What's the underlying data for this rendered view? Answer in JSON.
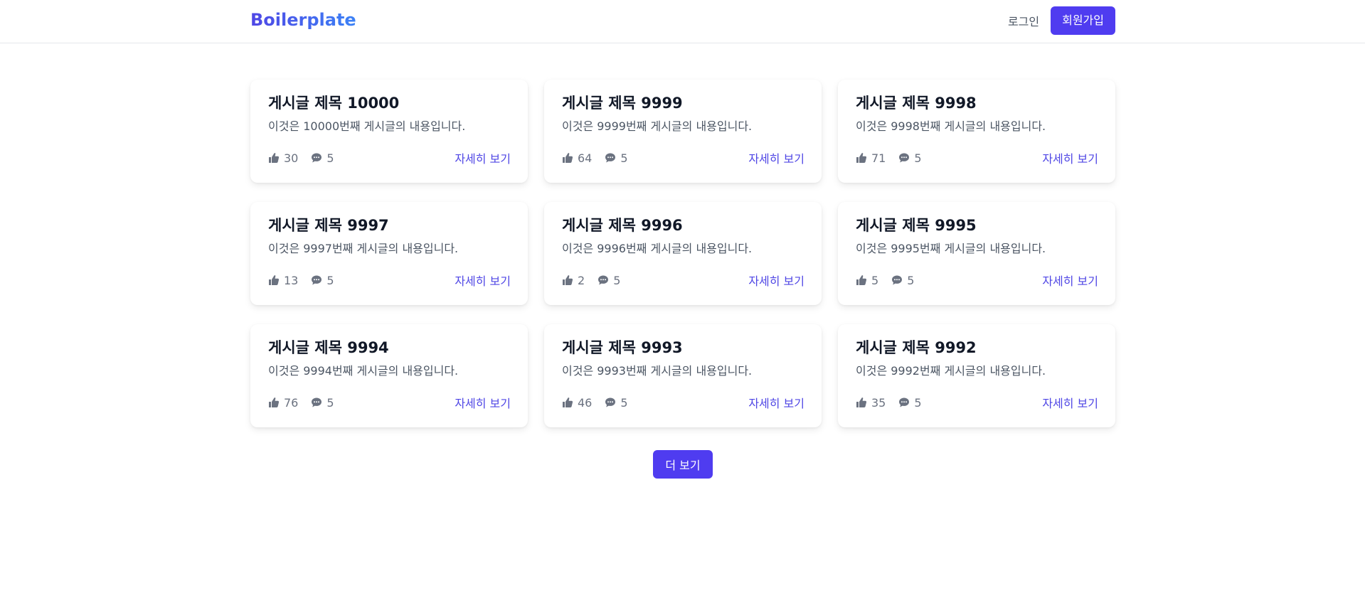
{
  "header": {
    "brand": "Boilerplate",
    "login_label": "로그인",
    "signup_label": "회원가입"
  },
  "posts": [
    {
      "title": "게시글 제목 10000",
      "body": "이것은 10000번째 게시글의 내용입니다.",
      "likes": "30",
      "comments": "5",
      "detail_label": "자세히 보기"
    },
    {
      "title": "게시글 제목 9999",
      "body": "이것은 9999번째 게시글의 내용입니다.",
      "likes": "64",
      "comments": "5",
      "detail_label": "자세히 보기"
    },
    {
      "title": "게시글 제목 9998",
      "body": "이것은 9998번째 게시글의 내용입니다.",
      "likes": "71",
      "comments": "5",
      "detail_label": "자세히 보기"
    },
    {
      "title": "게시글 제목 9997",
      "body": "이것은 9997번째 게시글의 내용입니다.",
      "likes": "13",
      "comments": "5",
      "detail_label": "자세히 보기"
    },
    {
      "title": "게시글 제목 9996",
      "body": "이것은 9996번째 게시글의 내용입니다.",
      "likes": "2",
      "comments": "5",
      "detail_label": "자세히 보기"
    },
    {
      "title": "게시글 제목 9995",
      "body": "이것은 9995번째 게시글의 내용입니다.",
      "likes": "5",
      "comments": "5",
      "detail_label": "자세히 보기"
    },
    {
      "title": "게시글 제목 9994",
      "body": "이것은 9994번째 게시글의 내용입니다.",
      "likes": "76",
      "comments": "5",
      "detail_label": "자세히 보기"
    },
    {
      "title": "게시글 제목 9993",
      "body": "이것은 9993번째 게시글의 내용입니다.",
      "likes": "46",
      "comments": "5",
      "detail_label": "자세히 보기"
    },
    {
      "title": "게시글 제목 9992",
      "body": "이것은 9992번째 게시글의 내용입니다.",
      "likes": "35",
      "comments": "5",
      "detail_label": "자세히 보기"
    }
  ],
  "load_more_label": "더 보기",
  "icons": {
    "like": "thumbs-up-icon",
    "comment": "comment-icon"
  },
  "colors": {
    "accent": "#4f3cf0",
    "link": "#4f46e5",
    "muted": "#6b7280"
  }
}
